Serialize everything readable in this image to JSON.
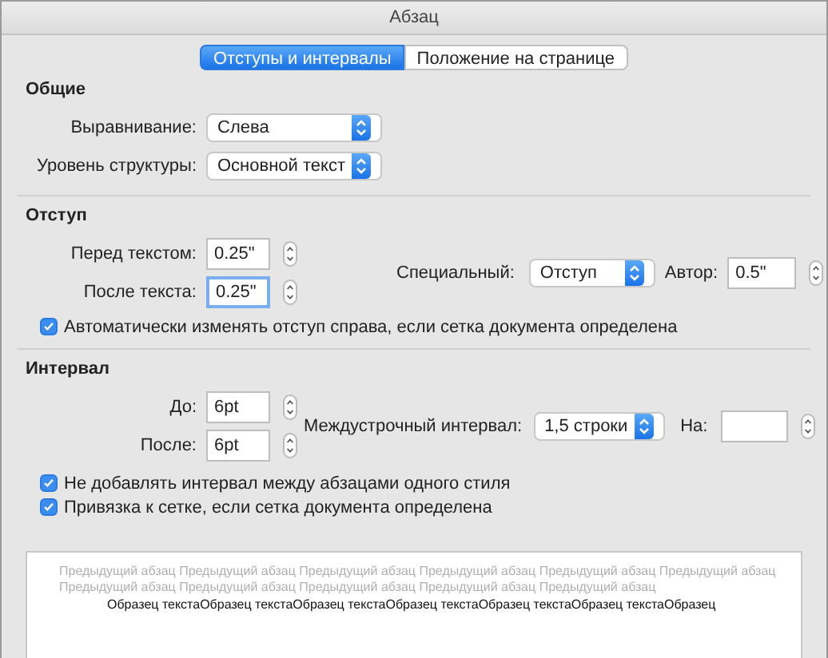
{
  "window": {
    "title": "Абзац"
  },
  "tabs": [
    {
      "label": "Отступы и интервалы",
      "selected": true
    },
    {
      "label": "Положение на странице",
      "selected": false
    }
  ],
  "general": {
    "heading": "Общие",
    "dropdowns": [
      {
        "label": "Выравнивание:",
        "value": "Слева"
      },
      {
        "label": "Уровень структуры:",
        "value": "Основной текст"
      }
    ]
  },
  "indent": {
    "heading": "Отступ",
    "fields": [
      {
        "label": "Перед текстом:",
        "value": "0.25\"",
        "focused": false
      },
      {
        "label": "После текста:",
        "value": "0.25\"",
        "focused": true
      }
    ],
    "special": {
      "label": "Специальный:",
      "value": "Отступ"
    },
    "by": {
      "label": "Автор:",
      "value": "0.5\""
    },
    "checkboxes": [
      {
        "label": "Автоматически изменять отступ справа, если сетка документа определена",
        "checked": true
      }
    ]
  },
  "spacing": {
    "heading": "Интервал",
    "fields": [
      {
        "label": "До:",
        "value": "6pt",
        "focused": false
      },
      {
        "label": "После:",
        "value": "6pt",
        "focused": false
      }
    ],
    "line_spacing": {
      "label": "Междустрочный интервал:",
      "value": "1,5 строки"
    },
    "at": {
      "label": "На:"
    },
    "checkboxes": [
      {
        "label": "Не добавлять интервал между абзацами одного стиля",
        "checked": true
      },
      {
        "label": "Привязка к сетке, если сетка документа определена",
        "checked": true
      }
    ]
  },
  "preview": {
    "previous_lines": [
      "Предыдущий абзац Предыдущий абзац Предыдущий абзац Предыдущий абзац Предыдущий абзац Предыдущий абзац",
      "Предыдущий абзац Предыдущий абзац Предыдущий абзац Предыдущий абзац Предыдущий абзац"
    ],
    "sample": "Образец текстаОбразец текстаОбразец текстаОбразец текстаОбразец текстаОбразец текстаОбразец"
  }
}
